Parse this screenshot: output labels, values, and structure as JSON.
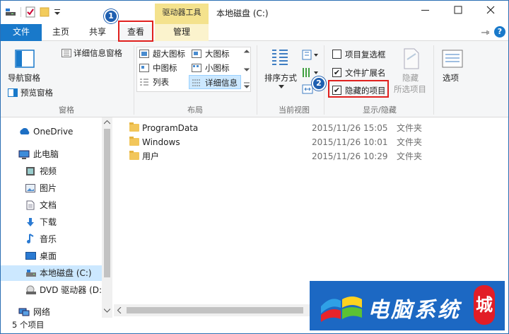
{
  "window": {
    "title": "本地磁盘 (C:)",
    "contextual_tab": "驱动器工具"
  },
  "tabs": {
    "file": "文件",
    "home": "主页",
    "share": "共享",
    "view": "查看",
    "manage": "管理"
  },
  "ribbon": {
    "nav_pane": "导航窗格",
    "preview_pane": "预览窗格",
    "details_pane": "详细信息窗格",
    "group_panes": "窗格",
    "extra_large": "超大图标",
    "large": "大图标",
    "medium": "中图标",
    "small": "小图标",
    "list": "列表",
    "details": "详细信息",
    "group_layout": "布局",
    "sort_by": "排序方式",
    "group_current_view": "当前视图",
    "item_checkboxes": "项目复选框",
    "file_extensions": "文件扩展名",
    "hidden_items": "隐藏的项目",
    "hide_label": "隐藏",
    "hide_selected": "所选项目",
    "group_show_hide": "显示/隐藏",
    "options": "选项"
  },
  "checkboxes": {
    "item_checkboxes": false,
    "file_extensions": true,
    "hidden_items": true
  },
  "badges": {
    "one": "1",
    "two": "2"
  },
  "nav": [
    {
      "label": "OneDrive"
    },
    {
      "label": "此电脑"
    },
    {
      "label": "视频"
    },
    {
      "label": "图片"
    },
    {
      "label": "文档"
    },
    {
      "label": "下载"
    },
    {
      "label": "音乐"
    },
    {
      "label": "桌面"
    },
    {
      "label": "本地磁盘 (C:)"
    },
    {
      "label": "DVD 驱动器 (D:"
    },
    {
      "label": "网络"
    }
  ],
  "files": [
    {
      "name": "ProgramData",
      "date": "2015/11/26 15:05",
      "type": "文件夹"
    },
    {
      "name": "Windows",
      "date": "2015/11/26 10:01",
      "type": "文件夹"
    },
    {
      "name": "用户",
      "date": "2015/11/26 10:29",
      "type": "文件夹"
    }
  ],
  "status": {
    "count": "5 个项目"
  },
  "watermark": {
    "text": "电脑系统",
    "badge": "城"
  },
  "colors": {
    "accent": "#1979ca",
    "highlight": "#e0201e",
    "contextual": "#f4e28d",
    "selected": "#cce8ff"
  }
}
